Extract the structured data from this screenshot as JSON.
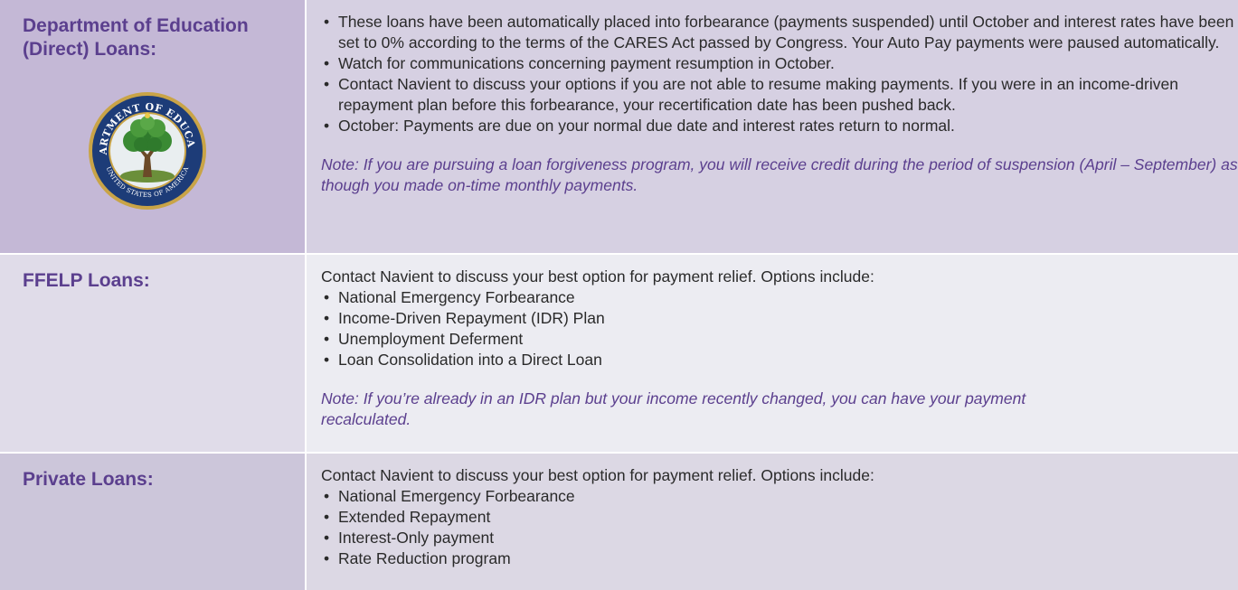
{
  "rows": [
    {
      "label": "Department of Education\n(Direct) Loans:",
      "seal_text": "DEPARTMENT OF EDUCATION · UNITED STATES OF AMERICA",
      "bullets": [
        "These loans have been automatically placed into forbearance (payments suspended) until October and interest rates have been set to 0% according to the terms of the CARES Act passed by Congress. Your Auto Pay payments were paused automatically.",
        "Watch for communications concerning payment resumption in October.",
        "Contact Navient to discuss your options if you are not able to resume making payments. If you were in an income-driven repayment plan before this forbearance, your recertification date has been pushed back.",
        "October: Payments are due on your normal due date and interest rates return to normal."
      ],
      "note": "Note: If you are pursuing a loan forgiveness program, you will receive credit during the period of suspension (April – September) as though you made on-time monthly payments."
    },
    {
      "label": "FFELP Loans:",
      "intro": "Contact Navient to discuss your best option for payment relief. Options include:",
      "bullets": [
        "National Emergency Forbearance",
        "Income-Driven Repayment (IDR) Plan",
        "Unemployment Deferment",
        "Loan Consolidation into a Direct Loan"
      ],
      "note": "Note: If you’re already in an IDR plan but your income recently changed, you can have your payment recalculated."
    },
    {
      "label": "Private Loans:",
      "intro": "Contact Navient to discuss your best option for payment relief. Options include:",
      "bullets": [
        "National Emergency Forbearance",
        "Extended Repayment",
        "Interest-Only payment",
        "Rate Reduction program"
      ]
    }
  ],
  "colors": {
    "label_text": "#5b3f8e",
    "note_text": "#5b3f8e",
    "body_text": "#2a2a2a",
    "row1_label_bg": "#c4b8d6",
    "row1_content_bg": "#d6d0e2",
    "row2_label_bg": "#e0dce9",
    "row2_content_bg": "#ececf2",
    "row3_label_bg": "#ccc6da",
    "row3_content_bg": "#dcd8e4"
  },
  "icons": {
    "seal": "department-of-education-seal-icon"
  }
}
